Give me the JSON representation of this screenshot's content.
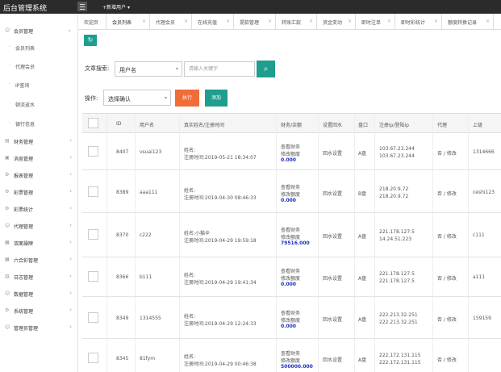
{
  "app": {
    "title": "后台管理系统",
    "new_user_label": "+新增用户"
  },
  "sidebar": {
    "items": [
      {
        "label": "会员管理",
        "expanded": true,
        "icon": "user-icon"
      },
      {
        "label": "会员列表",
        "sub": true
      },
      {
        "label": "代理会员",
        "sub": true
      },
      {
        "label": "IP查询",
        "sub": true
      },
      {
        "label": "顿流返水",
        "sub": true
      },
      {
        "label": "银行信息",
        "sub": true
      },
      {
        "label": "财务管理"
      },
      {
        "label": "消息管理"
      },
      {
        "label": "报表管理"
      },
      {
        "label": "彩票管理"
      },
      {
        "label": "彩票统计"
      },
      {
        "label": "代理管理"
      },
      {
        "label": "双面操牌"
      },
      {
        "label": "六合彩管理"
      },
      {
        "label": "日志管理"
      },
      {
        "label": "数据管理"
      },
      {
        "label": "系统管理"
      },
      {
        "label": "管理员管理"
      }
    ]
  },
  "tabs": [
    {
      "label": "欢迎页"
    },
    {
      "label": "会员列表",
      "active": true
    },
    {
      "label": "代理会员"
    },
    {
      "label": "在线充值"
    },
    {
      "label": "提款管理"
    },
    {
      "label": "转账汇款"
    },
    {
      "label": "资金变动"
    },
    {
      "label": "即时注单"
    },
    {
      "label": "即时彩统计"
    },
    {
      "label": "额度转换记录"
    }
  ],
  "search": {
    "label": "文章搜索:",
    "select_value": "用户名",
    "placeholder": "请输入关键字"
  },
  "ops": {
    "label": "操作:",
    "select_value": "选择确认",
    "execute_label": "执行",
    "add_label": "添加"
  },
  "table": {
    "headers": [
      "ID",
      "用户名",
      "真实姓名/注册时间",
      "财务/余额",
      "设置回水",
      "盘口",
      "注册ip/登陆ip",
      "代理",
      "上级"
    ],
    "rows": [
      {
        "id": "8407",
        "username": "vsuai123",
        "name": "姓名:",
        "reg_time": "注册时间:2019-05-21 18:34:07",
        "fin1": "查看财务",
        "fin2": "修改额度",
        "balance": "0.000",
        "rebate": "回水设置",
        "pan": "A盘",
        "ip1": "103.67.23.244",
        "ip2": "103.67.23.244",
        "agent": "否 / 修改",
        "parent": "1314666"
      },
      {
        "id": "8389",
        "username": "aaa111",
        "name": "姓名:",
        "reg_time": "注册时间:2019-04-30 08:46:33",
        "fin1": "查看财务",
        "fin2": "修改额度",
        "balance": "0.000",
        "rebate": "回水设置",
        "pan": "B盘",
        "ip1": "218.20.9.72",
        "ip2": "218.20.9.72",
        "agent": "否 / 修改",
        "parent": "ceshi123"
      },
      {
        "id": "8370",
        "username": "c222",
        "name": "姓名:小猫辛",
        "reg_time": "注册时间:2019-04-29 19:59:18",
        "fin1": "查看财务",
        "fin2": "修改额度",
        "balance": "79516.000",
        "rebate": "回水设置",
        "pan": "A盘",
        "ip1": "221.178.127.5",
        "ip2": "14.24.51.223",
        "agent": "否 / 修改",
        "parent": "c111"
      },
      {
        "id": "8366",
        "username": "b111",
        "name": "姓名:",
        "reg_time": "注册时间:2019-04-29 19:41:34",
        "fin1": "查看财务",
        "fin2": "修改额度",
        "balance": "0.000",
        "rebate": "回水设置",
        "pan": "A盘",
        "ip1": "221.178.127.5",
        "ip2": "221.178.127.5",
        "agent": "否 / 修改",
        "parent": "a111"
      },
      {
        "id": "8349",
        "username": "1314555",
        "name": "姓名:",
        "reg_time": "注册时间:2019-04-29 12:24:33",
        "fin1": "查看财务",
        "fin2": "修改额度",
        "balance": "0.000",
        "rebate": "回水设置",
        "pan": "A盘",
        "ip1": "222.213.32.251",
        "ip2": "222.213.32.251",
        "agent": "否 / 修改",
        "parent": "159159"
      },
      {
        "id": "8345",
        "username": "81fym",
        "name": "姓名:",
        "reg_time": "注册时间:2019-04-29 00:46:38",
        "fin1": "查看财务",
        "fin2": "修改额度",
        "balance": "500000.000",
        "rebate": "回水设置",
        "pan": "A盘",
        "ip1": "222.172.131.115",
        "ip2": "222.172.131.115",
        "agent": "否 / 修改",
        "parent": ""
      }
    ]
  }
}
